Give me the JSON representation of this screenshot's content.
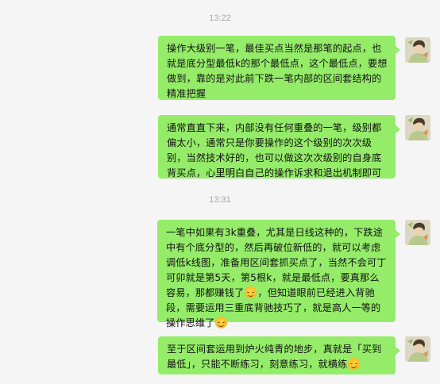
{
  "timestamps": [
    "13:22",
    "13:31"
  ],
  "messages": [
    {
      "text": "操作大级别一笔，最佳买点当然是那笔的起点，也就是底分型最低k的那个最低点，这个最低点，要想做到，靠的是对此前下跌一笔内部的区间套结构的精准把握"
    },
    {
      "text": "通常直直下来，内部没有任何重叠的一笔，级别都偏太小，通常只是你要操作的这个级别的次次级别，当然技术好的，也可以做这次次级别的自身底背买点，心里明白自己的操作诉求和退出机制即可"
    },
    {
      "text_before": "一笔中如果有3k重叠，尤其是日线这种的，下跌途中有个底分型的，然后再破位新低的，就可以考虑调低k线图，准备用区间套抓买点了，当然不会可丁可卯就是第5天，第5根k，就是最低点，要真那么容易，那都赚钱了",
      "text_middle": "，但知道眼前已经进入背驰段，需要运用三重底背驰技巧了，就是高人一等的操作思维了",
      "emoji_a": "grin-sweat",
      "emoji_b": "smirk"
    },
    {
      "text_before": "至于区间套运用到炉火纯青的地步，真就是「买到最低」，只能不断练习，刻意练习，就横练",
      "emoji": "tongue-out"
    }
  ],
  "avatar_icon": "user-avatar-icon",
  "colors": {
    "bubble": "#95ec69",
    "background": "#f5f5f5",
    "timestamp": "#a6a6a6"
  }
}
